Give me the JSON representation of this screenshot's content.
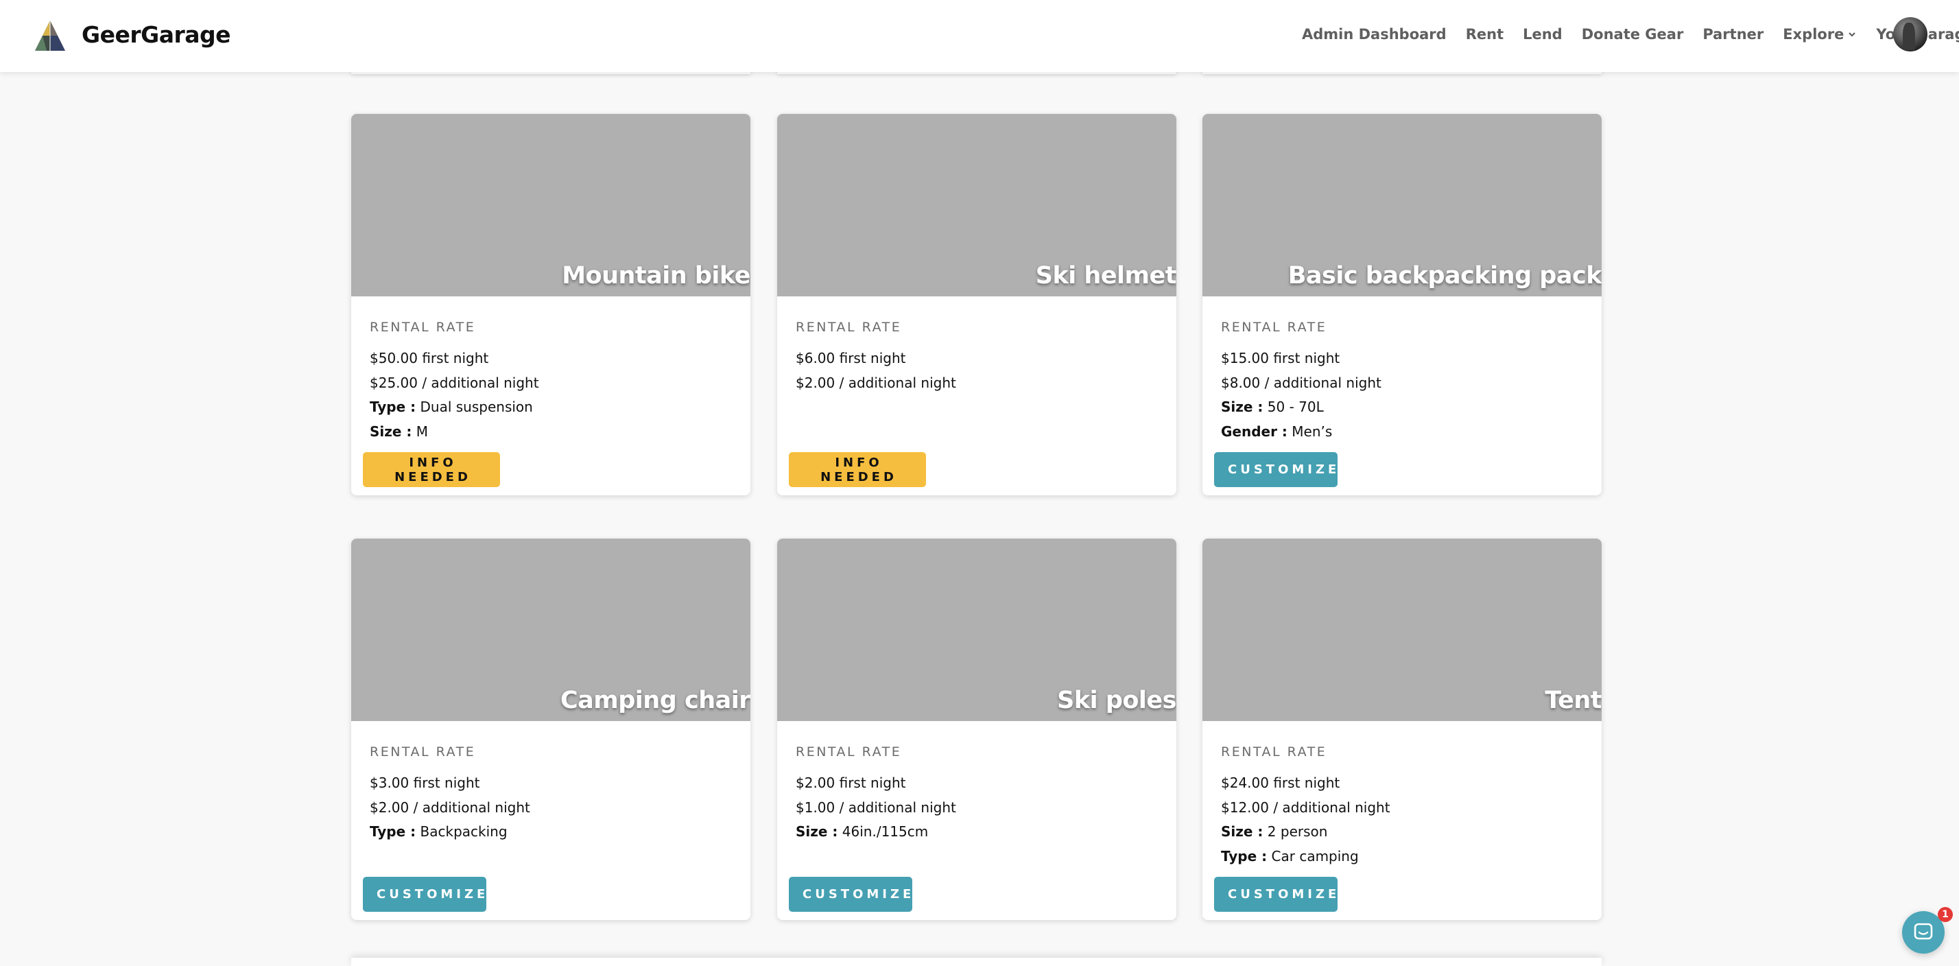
{
  "header": {
    "brand_name": "GeerGarage",
    "nav": {
      "admin_dashboard": "Admin Dashboard",
      "rent": "Rent",
      "lend": "Lend",
      "donate_gear": "Donate Gear",
      "partner": "Partner",
      "explore": "Explore",
      "your_garage": "Your garage"
    }
  },
  "rental_rate_label": "RENTAL RATE",
  "cards": [
    {
      "title": "Mountain bike",
      "first_night": "$50.00 first night",
      "additional_night": "$25.00 / additional night",
      "attrs": [
        {
          "key": "Type :",
          "value": "Dual suspension"
        },
        {
          "key": "Size :",
          "value": "M"
        }
      ],
      "action": "INFO NEEDED",
      "action_kind": "info"
    },
    {
      "title": "Ski helmet",
      "first_night": "$6.00 first night",
      "additional_night": "$2.00 / additional night",
      "attrs": [],
      "action": "INFO NEEDED",
      "action_kind": "info"
    },
    {
      "title": "Basic backpacking pack",
      "first_night": "$15.00 first night",
      "additional_night": "$8.00 / additional night",
      "attrs": [
        {
          "key": "Size :",
          "value": "50 - 70L"
        },
        {
          "key": "Gender :",
          "value": "Men’s"
        }
      ],
      "action": "CUSTOMIZE",
      "action_kind": "customize"
    },
    {
      "title": "Camping chair",
      "first_night": "$3.00 first night",
      "additional_night": "$2.00 / additional night",
      "attrs": [
        {
          "key": "Type :",
          "value": "Backpacking"
        }
      ],
      "action": "CUSTOMIZE",
      "action_kind": "customize"
    },
    {
      "title": "Ski poles",
      "first_night": "$2.00 first night",
      "additional_night": "$1.00 / additional night",
      "attrs": [
        {
          "key": "Size :",
          "value": "46in./115cm"
        }
      ],
      "action": "CUSTOMIZE",
      "action_kind": "customize"
    },
    {
      "title": "Tent",
      "first_night": "$24.00 first night",
      "additional_night": "$12.00 / additional night",
      "attrs": [
        {
          "key": "Size :",
          "value": "2 person"
        },
        {
          "key": "Type :",
          "value": "Car camping"
        }
      ],
      "action": "CUSTOMIZE",
      "action_kind": "customize"
    }
  ],
  "chat": {
    "badge_count": "1"
  },
  "colors": {
    "info_button": "#f6be3e",
    "customize_button": "#45a0b2",
    "image_placeholder": "#b0b0b0",
    "chat_widget": "#4aa6b8"
  }
}
